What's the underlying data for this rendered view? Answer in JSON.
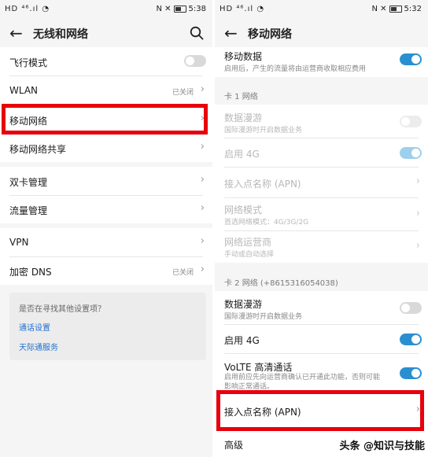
{
  "left": {
    "statusbar": {
      "left": "HD ⁴⁶.ıl ◔",
      "right_icons": "N ✕",
      "time": "5:38"
    },
    "appbar": {
      "title": "无线和网络"
    },
    "items": [
      {
        "label": "飞行模式",
        "toggle": "off"
      },
      {
        "label": "WLAN",
        "status": "已关闭"
      },
      {
        "label": "移动网络"
      },
      {
        "label": "移动网络共享"
      },
      {
        "label": "双卡管理"
      },
      {
        "label": "流量管理"
      },
      {
        "label": "VPN"
      },
      {
        "label": "加密 DNS",
        "status": "已关闭"
      }
    ],
    "suggest": {
      "question": "是否在寻找其他设置项？",
      "links": [
        "通话设置",
        "天际通服务"
      ]
    }
  },
  "right": {
    "statusbar": {
      "left": "HD ⁴⁶.ıl ◔",
      "right_icons": "N ✕",
      "time": "5:32"
    },
    "appbar": {
      "title": "移动网络"
    },
    "mobile_data": {
      "title": "移动数据",
      "sub": "启用后，产生的流量将由运营商收取相应费用",
      "toggle": "on"
    },
    "sim1": {
      "header": "卡 1 网络",
      "items": [
        {
          "title": "数据漫游",
          "sub": "国际漫游时开启数据业务",
          "toggle": "off"
        },
        {
          "title": "启用 4G",
          "toggle": "on"
        },
        {
          "title": "接入点名称 (APN)"
        },
        {
          "title": "网络模式",
          "sub": "首选网络模式：4G/3G/2G"
        },
        {
          "title": "网络运营商",
          "sub": "手动或自动选择"
        }
      ]
    },
    "sim2": {
      "header": "卡 2 网络 (+8615316054038)",
      "items": [
        {
          "title": "数据漫游",
          "sub": "国际漫游时开启数据业务",
          "toggle": "off"
        },
        {
          "title": "启用 4G",
          "toggle": "on"
        },
        {
          "title": "VoLTE 高清通话",
          "sub": "启用前应先向运营商确认已开通此功能，否则可能影响正常通话。",
          "sub_line2": "能影响正常通话。",
          "toggle": "on"
        },
        {
          "title": "接入点名称 (APN)"
        },
        {
          "title": "高级"
        }
      ]
    }
  },
  "watermark": "头条 @知识与技能",
  "colors": {
    "accent": "#2a8fd1",
    "highlight": "#e8000c",
    "link": "#1f6fcf"
  }
}
